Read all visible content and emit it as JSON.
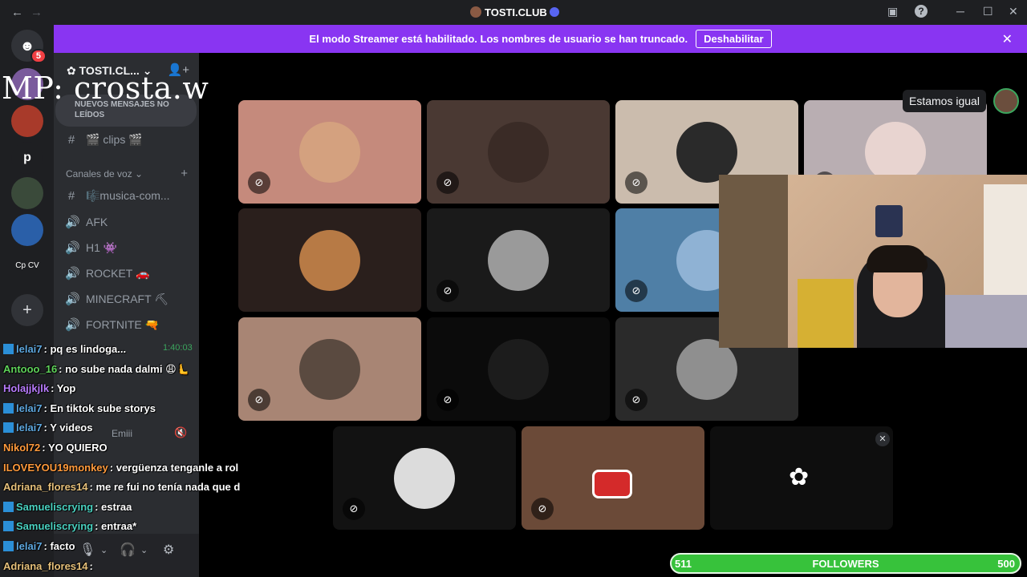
{
  "window": {
    "title": "TOSTI.CLUB",
    "back": "←",
    "forward": "→"
  },
  "banner": {
    "text": "El modo Streamer está habilitado. Los nombres de usuario se han truncado.",
    "button": "Deshabilitar",
    "close": "✕"
  },
  "rail": {
    "dm_badge": "5",
    "server_p": "p",
    "server_cp_cv": "Cp CV",
    "add": "+"
  },
  "sidebar": {
    "server_name": "TOSTI.CL...",
    "new_messages": "NUEVOS MENSAJES NO LEÍDOS",
    "clips": "🎬 clips 🎬",
    "voice_category": "Canales de voz",
    "channels": [
      {
        "icon": "#",
        "name": "🎼musica-com..."
      },
      {
        "icon": "🔊",
        "name": "AFK"
      },
      {
        "icon": "🔊",
        "name": "H1 👾"
      },
      {
        "icon": "🔊",
        "name": "ROCKET 🚗"
      },
      {
        "icon": "🔊",
        "name": "MINECRAFT ⛏"
      },
      {
        "icon": "🔊",
        "name": "FORTNITE 🔫"
      }
    ]
  },
  "watermark": "MP: crosta.w",
  "stage": {
    "speaking_label": "Estamos igual",
    "tiles": [
      {
        "bg": "#c58a7c",
        "av": "#d4a17f",
        "muted": true
      },
      {
        "bg": "#4a3933",
        "av": "#3a2b26",
        "muted": true
      },
      {
        "bg": "#cbbcad",
        "av": "#2a2a2a",
        "muted": true
      },
      {
        "bg": "#b9aeb2",
        "av": "#e8d4d0",
        "muted": true
      },
      {
        "bg": "#2a1f1c",
        "av": "#b77a45",
        "muted": false
      },
      {
        "bg": "#1a1a1a",
        "av": "#9a9a9a",
        "muted": true
      },
      {
        "bg": "#4f7fa6",
        "av": "#8fb2d4",
        "muted": true
      },
      {
        "bg": "#eec4b7",
        "av": "#3a2a22",
        "muted": false
      },
      {
        "bg": "#a88574",
        "av": "#5a4a40",
        "muted": true
      },
      {
        "bg": "#0b0b0b",
        "av": "#1c1c1c",
        "muted": true
      },
      {
        "bg": "#2a2a2a",
        "av": "#8f8f8f",
        "muted": true
      }
    ],
    "bottom_tiles": [
      {
        "bg": "#121212",
        "av": "#dcdcdc",
        "muted": true
      },
      {
        "bg": "#6b4a38",
        "av": "#6b4a38",
        "muted": true
      },
      {
        "bg": "#0e0e0e",
        "av": "#0e0e0e",
        "muted": false
      }
    ],
    "activity_close": "✕"
  },
  "chat": [
    {
      "user": "lelai7",
      "color": "#5ea8e0",
      "text": ": pq es lindoga...",
      "tw": true
    },
    {
      "user": "Antooo_16",
      "color": "#5fd35a",
      "text": ": no sube nada dalmi 😩🫷",
      "tw": false
    },
    {
      "user": "Holajjkjlk",
      "color": "#b97cff",
      "text": ": Yop",
      "tw": false
    },
    {
      "user": "lelai7",
      "color": "#5ea8e0",
      "text": ": En tiktok sube storys",
      "tw": true
    },
    {
      "user": "lelai7",
      "color": "#5ea8e0",
      "text": ": Y videos",
      "tw": true
    },
    {
      "user": "Nikol72",
      "color": "#ff9a3c",
      "text": ": YO QUIERO",
      "tw": false
    },
    {
      "user": "ILOVEYOU19monkey",
      "color": "#ff9a3c",
      "text": ": vergüenza tenganle a rol",
      "tw": false
    },
    {
      "user": "Adriana_flores14",
      "color": "#e6c07a",
      "text": ": me re fui no tenía nada que d",
      "tw": false
    },
    {
      "user": "Samueliscrying",
      "color": "#49d1c0",
      "text": ": estraa",
      "tw": true
    },
    {
      "user": "Samueliscrying",
      "color": "#49d1c0",
      "text": ": entraa*",
      "tw": true
    },
    {
      "user": "lelai7",
      "color": "#5ea8e0",
      "text": ": facto",
      "tw": true
    },
    {
      "user": "Adriana_flores14",
      "color": "#e6c07a",
      "text": ":",
      "tw": false
    }
  ],
  "chat_timestamp": "1:40:03",
  "chat_member": "Emiii",
  "followers": {
    "current": "511",
    "label": "FOLLOWERS",
    "goal": "500",
    "progress": 1.0
  }
}
